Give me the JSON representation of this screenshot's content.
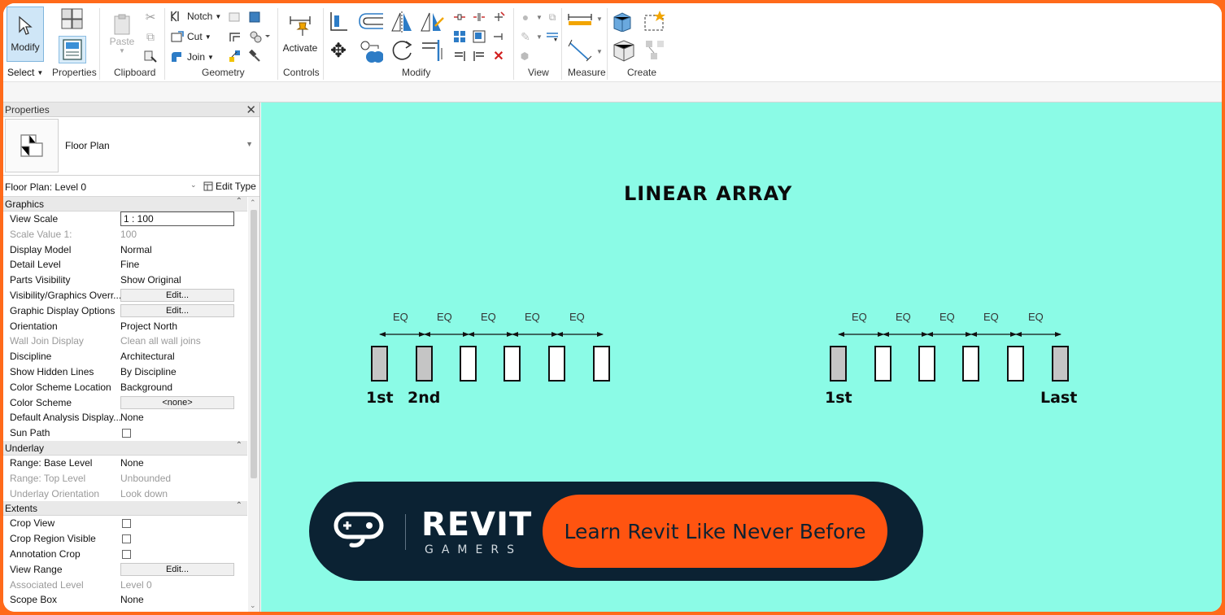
{
  "ribbon": {
    "modify_label": "Modify",
    "select_label": "Select",
    "paste_label": "Paste",
    "notch_label": "Notch",
    "cut_label": "Cut",
    "join_label": "Join",
    "activate_label": "Activate",
    "panels": {
      "select": "Select",
      "properties": "Properties",
      "clipboard": "Clipboard",
      "geometry": "Geometry",
      "controls": "Controls",
      "modify": "Modify",
      "view": "View",
      "measure": "Measure",
      "create": "Create"
    }
  },
  "properties": {
    "title": "Properties",
    "type_name": "Floor Plan",
    "instance": "Floor Plan: Level 0",
    "edit_type": "Edit Type",
    "sections": {
      "graphics": "Graphics",
      "underlay": "Underlay",
      "extents": "Extents"
    },
    "graphics_rows": [
      {
        "k": "View Scale",
        "v": "1 : 100"
      },
      {
        "k": "Scale Value    1:",
        "v": "100"
      },
      {
        "k": "Display Model",
        "v": "Normal"
      },
      {
        "k": "Detail Level",
        "v": "Fine"
      },
      {
        "k": "Parts Visibility",
        "v": "Show Original"
      },
      {
        "k": "Visibility/Graphics Overr...",
        "v": "Edit..."
      },
      {
        "k": "Graphic Display Options",
        "v": "Edit..."
      },
      {
        "k": "Orientation",
        "v": "Project North"
      },
      {
        "k": "Wall Join Display",
        "v": "Clean all wall joins"
      },
      {
        "k": "Discipline",
        "v": "Architectural"
      },
      {
        "k": "Show Hidden Lines",
        "v": "By Discipline"
      },
      {
        "k": "Color Scheme Location",
        "v": "Background"
      },
      {
        "k": "Color Scheme",
        "v": "<none>"
      },
      {
        "k": "Default Analysis Display...",
        "v": "None"
      },
      {
        "k": "Sun Path",
        "v": ""
      }
    ],
    "underlay_rows": [
      {
        "k": "Range: Base Level",
        "v": "None"
      },
      {
        "k": "Range: Top Level",
        "v": "Unbounded"
      },
      {
        "k": "Underlay Orientation",
        "v": "Look down"
      }
    ],
    "extents_rows": [
      {
        "k": "Crop View",
        "v": ""
      },
      {
        "k": "Crop Region Visible",
        "v": ""
      },
      {
        "k": "Annotation Crop",
        "v": ""
      },
      {
        "k": "View Range",
        "v": "Edit..."
      },
      {
        "k": "Associated Level",
        "v": "Level 0"
      },
      {
        "k": "Scope Box",
        "v": "None"
      }
    ]
  },
  "canvas": {
    "title": "LINEAR  ARRAY",
    "eq": "EQ",
    "label_1st": "1st",
    "label_2nd": "2nd",
    "label_last": "Last"
  },
  "banner": {
    "brand_main": "REVIT",
    "brand_sub": "GAMERS",
    "cta": "Learn Revit Like Never Before"
  },
  "colors": {
    "canvas_bg": "#8bfbe6",
    "border_accent": "#ff6a1a",
    "banner_bg": "#0b2233",
    "cta_bg": "#ff5410"
  }
}
